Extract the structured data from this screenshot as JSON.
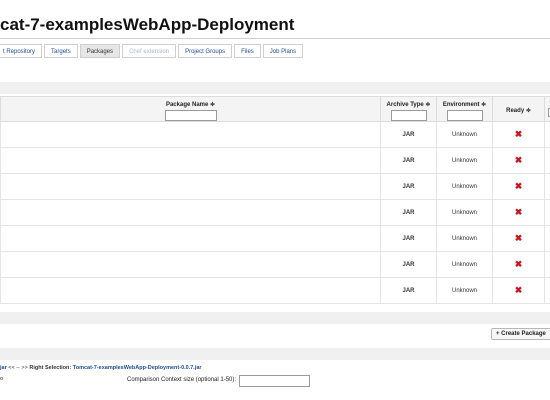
{
  "page": {
    "title": "cat-7-examplesWebApp-Deployment"
  },
  "tabs": [
    {
      "label": "t Repository",
      "state": "normal"
    },
    {
      "label": "Targets",
      "state": "normal"
    },
    {
      "label": "Packages",
      "state": "active"
    },
    {
      "label": "Chef extension",
      "state": "disabled"
    },
    {
      "label": "Project Groups",
      "state": "normal"
    },
    {
      "label": "Files",
      "state": "normal"
    },
    {
      "label": "Job Plans",
      "state": "normal"
    }
  ],
  "table": {
    "columns": {
      "package_name": "Package Name ≑",
      "archive_type": "Archive Type ≑",
      "environment": "Environment ≑",
      "ready": "Ready ≑"
    },
    "rows": [
      {
        "archive_type": "JAR",
        "environment": "Unknown",
        "ready_icon": "x-icon"
      },
      {
        "archive_type": "JAR",
        "environment": "Unknown",
        "ready_icon": "x-icon"
      },
      {
        "archive_type": "JAR",
        "environment": "Unknown",
        "ready_icon": "x-icon"
      },
      {
        "archive_type": "JAR",
        "environment": "Unknown",
        "ready_icon": "x-icon"
      },
      {
        "archive_type": "JAR",
        "environment": "Unknown",
        "ready_icon": "x-icon"
      },
      {
        "archive_type": "JAR",
        "environment": "Unknown",
        "ready_icon": "x-icon"
      },
      {
        "archive_type": "JAR",
        "environment": "Unknown",
        "ready_icon": "x-icon"
      }
    ],
    "ready_glyph": "✖"
  },
  "actions": {
    "create_package": "+ Create Package"
  },
  "compare": {
    "left_fragment": "jar",
    "arrows": "<< -- >>",
    "right_label": "Right Selection:",
    "right_value": "Tomcat-7-examplesWebApp-Deployment-0.0.7.jar",
    "left_text_fragment": "o",
    "context_label": "Comparison Context size (optional 1-50):",
    "context_value": ""
  },
  "colors": {
    "accent_link": "#1f4d92",
    "error_icon": "#c8161d"
  }
}
